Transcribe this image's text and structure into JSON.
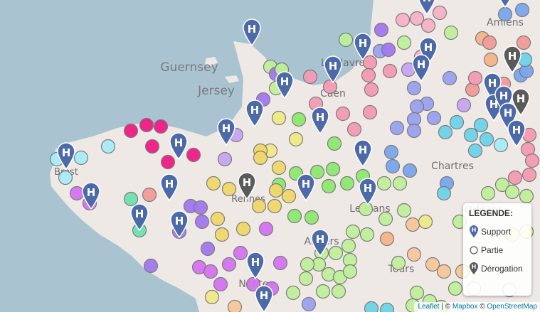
{
  "map": {
    "labels": [
      {
        "text": "Guernsey",
        "kind": "island"
      },
      {
        "text": "Jersey",
        "kind": "island"
      },
      {
        "text": "Le Havre",
        "kind": "city"
      },
      {
        "text": "Caen",
        "kind": "city"
      },
      {
        "text": "Brest",
        "kind": "city"
      },
      {
        "text": "Rennes",
        "kind": "city"
      },
      {
        "text": "Le Mans",
        "kind": "city"
      },
      {
        "text": "Chartres",
        "kind": "city"
      },
      {
        "text": "Angers",
        "kind": "city"
      },
      {
        "text": "Tours",
        "kind": "city"
      },
      {
        "text": "Amiens",
        "kind": "city"
      },
      {
        "text": "Orléans",
        "kind": "city"
      },
      {
        "text": "Nantes",
        "kind": "city"
      }
    ],
    "colors": {
      "sea": "#a9c4d0",
      "land": "#efe9e6",
      "support_marker": "#4d6aa8",
      "derogation_marker": "#5a5a5a"
    }
  },
  "legend": {
    "title": "LEGENDE:",
    "items": [
      {
        "label": "Support",
        "icon": "blue-h-marker-icon"
      },
      {
        "label": "Partie",
        "icon": "circle-outline-icon"
      },
      {
        "label": "Dérogation",
        "icon": "dark-h-marker-icon"
      }
    ]
  },
  "attribution": {
    "leaflet": "Leaflet",
    "separator": " | © ",
    "mapbox": "Mapbox",
    "separator2": " © ",
    "osm": "OpenStreetMap"
  }
}
